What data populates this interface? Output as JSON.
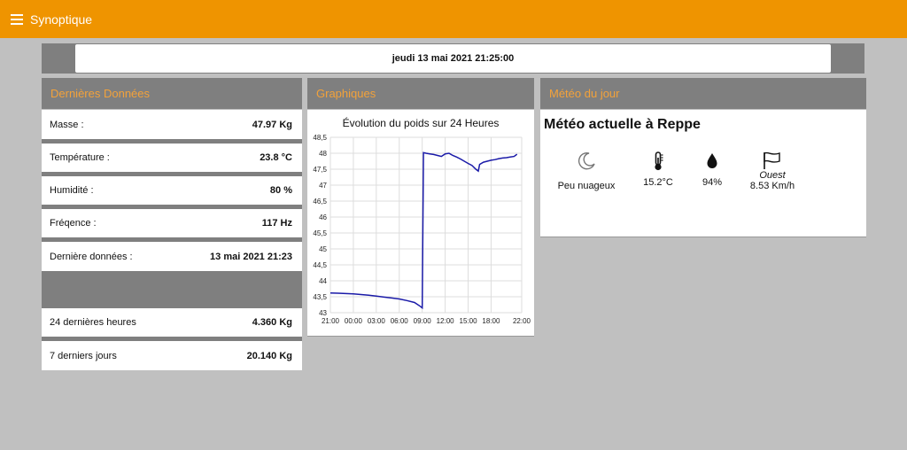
{
  "app": {
    "title": "Synoptique",
    "accent": "#ef9400"
  },
  "date_bar": {
    "text": "jeudi 13 mai 2021 21:25:00"
  },
  "panels": {
    "data_title": "Dernières Données",
    "chart_title": "Graphiques",
    "weather_title": "Météo du jour"
  },
  "latest": {
    "rows": [
      {
        "label": "Masse :",
        "value": "47.97 Kg"
      },
      {
        "label": "Température :",
        "value": "23.8 °C"
      },
      {
        "label": "Humidité :",
        "value": "80 %"
      },
      {
        "label": "Fréqence :",
        "value": "117 Hz"
      },
      {
        "label": "Dernière données :",
        "value": "13 mai 2021 21:23"
      }
    ],
    "summary": [
      {
        "label": "24 dernières heures",
        "value": "4.360 Kg"
      },
      {
        "label": "7 derniers jours",
        "value": "20.140 Kg"
      }
    ]
  },
  "chart_data": {
    "type": "line",
    "title": "Évolution du poids sur 24 Heures",
    "xlabel": "",
    "ylabel": "",
    "x_ticks": [
      "21:00",
      "00:00",
      "03:00",
      "06:00",
      "09:00",
      "12:00",
      "15:00",
      "18:00",
      "22:00"
    ],
    "y_ticks": [
      "43",
      "43,5",
      "44",
      "44,5",
      "45",
      "45,5",
      "46",
      "46,5",
      "47",
      "47,5",
      "48",
      "48,5"
    ],
    "ylim": [
      43,
      48.5
    ],
    "grid": true,
    "line_color": "#1a1aa8",
    "series": [
      {
        "values": [
          [
            "21:00",
            43.62
          ],
          [
            "22:00",
            43.61
          ],
          [
            "23:00",
            43.6
          ],
          [
            "00:00",
            43.59
          ],
          [
            "01:00",
            43.57
          ],
          [
            "02:00",
            43.55
          ],
          [
            "03:00",
            43.52
          ],
          [
            "04:00",
            43.49
          ],
          [
            "05:00",
            43.46
          ],
          [
            "06:00",
            43.43
          ],
          [
            "07:00",
            43.38
          ],
          [
            "08:00",
            43.32
          ],
          [
            "08:45",
            43.2
          ],
          [
            "09:00",
            43.15
          ],
          [
            "09:10",
            48.02
          ],
          [
            "09:30",
            48.0
          ],
          [
            "10:00",
            47.98
          ],
          [
            "10:30",
            47.96
          ],
          [
            "11:00",
            47.93
          ],
          [
            "11:30",
            47.9
          ],
          [
            "12:00",
            47.98
          ],
          [
            "12:30",
            48.0
          ],
          [
            "13:00",
            47.93
          ],
          [
            "13:30",
            47.88
          ],
          [
            "14:00",
            47.82
          ],
          [
            "14:30",
            47.75
          ],
          [
            "15:00",
            47.68
          ],
          [
            "15:30",
            47.62
          ],
          [
            "16:00",
            47.5
          ],
          [
            "16:20",
            47.44
          ],
          [
            "16:30",
            47.65
          ],
          [
            "17:00",
            47.72
          ],
          [
            "17:30",
            47.75
          ],
          [
            "18:00",
            47.78
          ],
          [
            "18:30",
            47.8
          ],
          [
            "19:00",
            47.83
          ],
          [
            "19:30",
            47.85
          ],
          [
            "20:00",
            47.86
          ],
          [
            "20:30",
            47.88
          ],
          [
            "21:00",
            47.9
          ],
          [
            "21:23",
            47.97
          ]
        ]
      }
    ]
  },
  "weather": {
    "title": "Météo actuelle à Reppe",
    "sky": {
      "icon": "moon-icon",
      "label": "Peu nuageux"
    },
    "temperature": {
      "icon": "thermometer-icon",
      "label": "15.2°C"
    },
    "humidity": {
      "icon": "droplet-icon",
      "label": "94%"
    },
    "wind": {
      "icon": "flag-icon",
      "direction": "Ouest",
      "speed": "8.53 Km/h"
    }
  }
}
